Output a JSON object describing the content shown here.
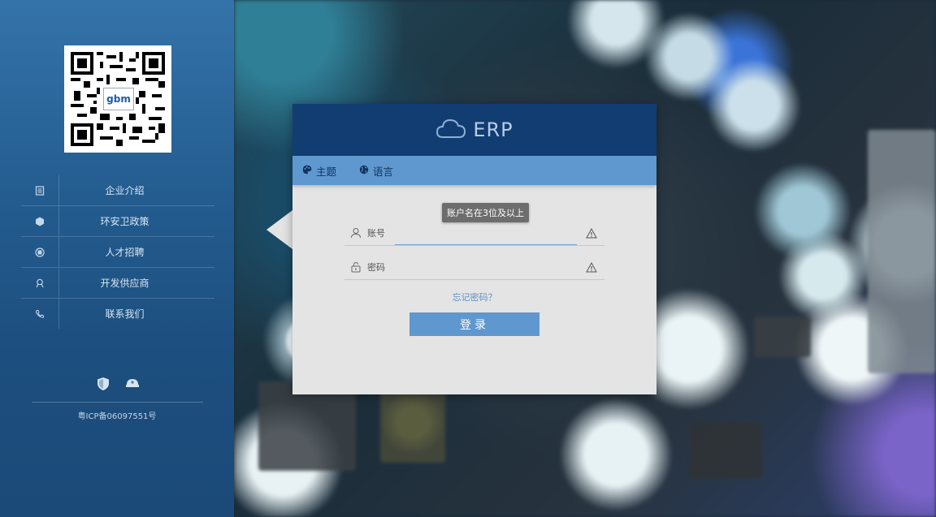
{
  "header": {
    "title": "ERP",
    "icon": "cloud-icon"
  },
  "toolbar": {
    "theme_label": "主题",
    "language_label": "语言"
  },
  "login": {
    "tooltip": "账户名在3位及以上",
    "username_label": "账号",
    "username_value": "",
    "password_label": "密码",
    "password_value": "",
    "forgot_label": "忘记密码？",
    "submit_label": "登录"
  },
  "sidebar": {
    "qr_logo": "gbm",
    "items": [
      {
        "label": "企业介绍",
        "icon": "document-icon"
      },
      {
        "label": "环安卫政策",
        "icon": "hexagon-icon"
      },
      {
        "label": "人才招聘",
        "icon": "badge-icon"
      },
      {
        "label": "开发供应商",
        "icon": "supplier-icon"
      },
      {
        "label": "联系我们",
        "icon": "phone-icon"
      }
    ],
    "social": [
      "shield-icon",
      "police-cap-icon"
    ],
    "icp": "粤ICP备06097551号"
  },
  "colors": {
    "sidebar": "#235b8e",
    "card_header": "#113d73",
    "accent": "#5f97cf",
    "card_bg": "#e4e4e4"
  }
}
